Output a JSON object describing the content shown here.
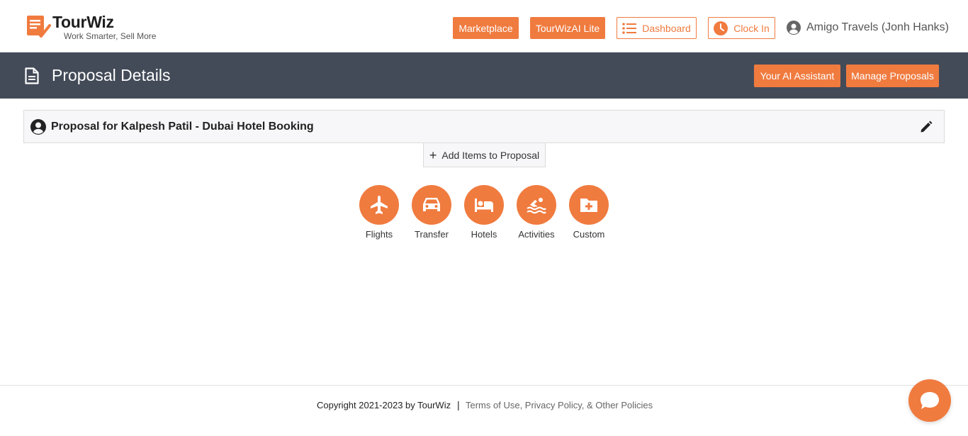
{
  "brand": {
    "name": "TourWiz",
    "tagline": "Work Smarter, Sell More",
    "accent": "#f07b3f",
    "header_bg": "#434b59"
  },
  "header": {
    "marketplace": "Marketplace",
    "tourwiz_ai_lite": "TourWizAI Lite",
    "dashboard": "Dashboard",
    "clock_in": "Clock In",
    "user": "Amigo Travels (Jonh Hanks)"
  },
  "page": {
    "title": "Proposal Details",
    "ai_assistant": "Your AI Assistant",
    "manage_proposals": "Manage Proposals"
  },
  "proposal": {
    "title": "Proposal for Kalpesh Patil - Dubai Hotel Booking",
    "add_items": "Add Items to Proposal"
  },
  "categories": [
    {
      "label": "Flights",
      "icon": "plane-icon"
    },
    {
      "label": "Transfer",
      "icon": "car-icon"
    },
    {
      "label": "Hotels",
      "icon": "bed-icon"
    },
    {
      "label": "Activities",
      "icon": "swimmer-icon"
    },
    {
      "label": "Custom",
      "icon": "folder-plus-icon"
    }
  ],
  "footer": {
    "copyright": "Copyright 2021-2023 by TourWiz",
    "separator": "|",
    "policies": "Terms of Use, Privacy Policy, & Other Policies"
  }
}
